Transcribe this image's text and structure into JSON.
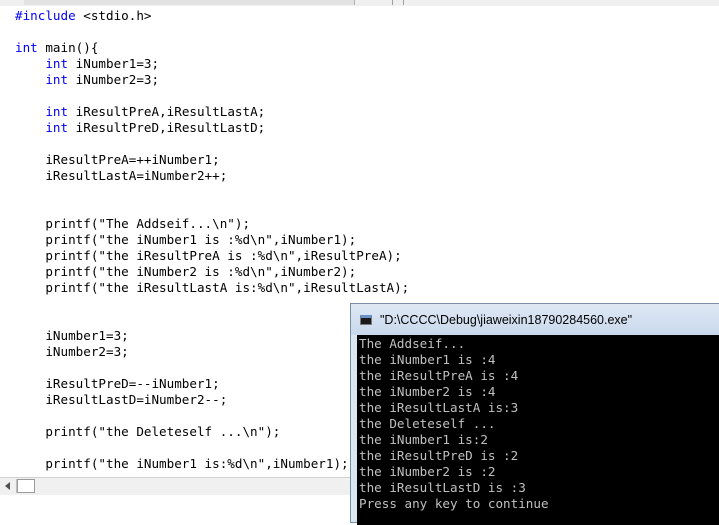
{
  "editor": {
    "lines": [
      {
        "parts": [
          {
            "t": "#include",
            "c": "pp"
          },
          {
            "t": " <stdio.h>",
            "c": ""
          }
        ]
      },
      {
        "parts": []
      },
      {
        "parts": [
          {
            "t": "int",
            "c": "kw"
          },
          {
            "t": " main(){",
            "c": ""
          }
        ]
      },
      {
        "parts": [
          {
            "t": "    ",
            "c": ""
          },
          {
            "t": "int",
            "c": "kw"
          },
          {
            "t": " iNumber1=3;",
            "c": ""
          }
        ]
      },
      {
        "parts": [
          {
            "t": "    ",
            "c": ""
          },
          {
            "t": "int",
            "c": "kw"
          },
          {
            "t": " iNumber2=3;",
            "c": ""
          }
        ]
      },
      {
        "parts": []
      },
      {
        "parts": [
          {
            "t": "    ",
            "c": ""
          },
          {
            "t": "int",
            "c": "kw"
          },
          {
            "t": " iResultPreA,iResultLastA;",
            "c": ""
          }
        ]
      },
      {
        "parts": [
          {
            "t": "    ",
            "c": ""
          },
          {
            "t": "int",
            "c": "kw"
          },
          {
            "t": " iResultPreD,iResultLastD;",
            "c": ""
          }
        ]
      },
      {
        "parts": []
      },
      {
        "parts": [
          {
            "t": "    iResultPreA=++iNumber1;",
            "c": ""
          }
        ]
      },
      {
        "parts": [
          {
            "t": "    iResultLastA=iNumber2++;",
            "c": ""
          }
        ]
      },
      {
        "parts": []
      },
      {
        "parts": []
      },
      {
        "parts": [
          {
            "t": "    printf(\"The Addseif...\\n\");",
            "c": ""
          }
        ]
      },
      {
        "parts": [
          {
            "t": "    printf(\"the iNumber1 is :%d\\n\",iNumber1);",
            "c": ""
          }
        ]
      },
      {
        "parts": [
          {
            "t": "    printf(\"the iResultPreA is :%d\\n\",iResultPreA);",
            "c": ""
          }
        ]
      },
      {
        "parts": [
          {
            "t": "    printf(\"the iNumber2 is :%d\\n\",iNumber2);",
            "c": ""
          }
        ]
      },
      {
        "parts": [
          {
            "t": "    printf(\"the iResultLastA is:%d\\n\",iResultLastA);",
            "c": ""
          }
        ]
      },
      {
        "parts": []
      },
      {
        "parts": []
      },
      {
        "parts": [
          {
            "t": "    iNumber1=3;",
            "c": ""
          }
        ]
      },
      {
        "parts": [
          {
            "t": "    iNumber2=3;",
            "c": ""
          }
        ]
      },
      {
        "parts": []
      },
      {
        "parts": [
          {
            "t": "    iResultPreD=--iNumber1;",
            "c": ""
          }
        ]
      },
      {
        "parts": [
          {
            "t": "    iResultLastD=iNumber2--;",
            "c": ""
          }
        ]
      },
      {
        "parts": []
      },
      {
        "parts": [
          {
            "t": "    printf(\"the Deleteself ...\\n\");",
            "c": ""
          }
        ]
      },
      {
        "parts": []
      },
      {
        "parts": [
          {
            "t": "    printf(\"the iNumber1 is:%d\\n\",iNumber1);",
            "c": ""
          }
        ]
      }
    ]
  },
  "console": {
    "title": "\"D:\\CCCC\\Debug\\jiaweixin18790284560.exe\"",
    "lines": [
      "The Addseif...",
      "the iNumber1 is :4",
      "the iResultPreA is :4",
      "the iNumber2 is :4",
      "the iResultLastA is:3",
      "the Deleteself ...",
      "the iNumber1 is:2",
      "the iResultPreD is :2",
      "the iNumber2 is :2",
      "the iResultLastD is :3",
      "Press any key to continue"
    ]
  },
  "colors": {
    "keyword": "#0000ff",
    "console_bg": "#000000",
    "console_text": "#c0c0c0"
  },
  "icons": {
    "console_icon": "console-window-icon",
    "scroll_left": "arrow-left-icon"
  }
}
